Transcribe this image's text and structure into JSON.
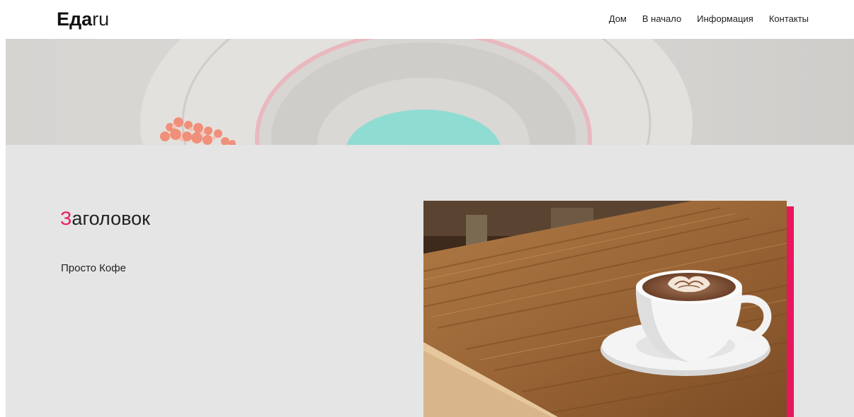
{
  "header": {
    "logo_bold": "Еда",
    "logo_thin": "ru",
    "nav": [
      "Дом",
      "В начало",
      "Информация",
      "Контакты"
    ]
  },
  "main": {
    "heading_accent": "З",
    "heading_rest": "аголовок",
    "subtext": "Просто Кофе"
  },
  "colors": {
    "accent": "#e8175d",
    "content_bg": "#e5e5e5"
  }
}
